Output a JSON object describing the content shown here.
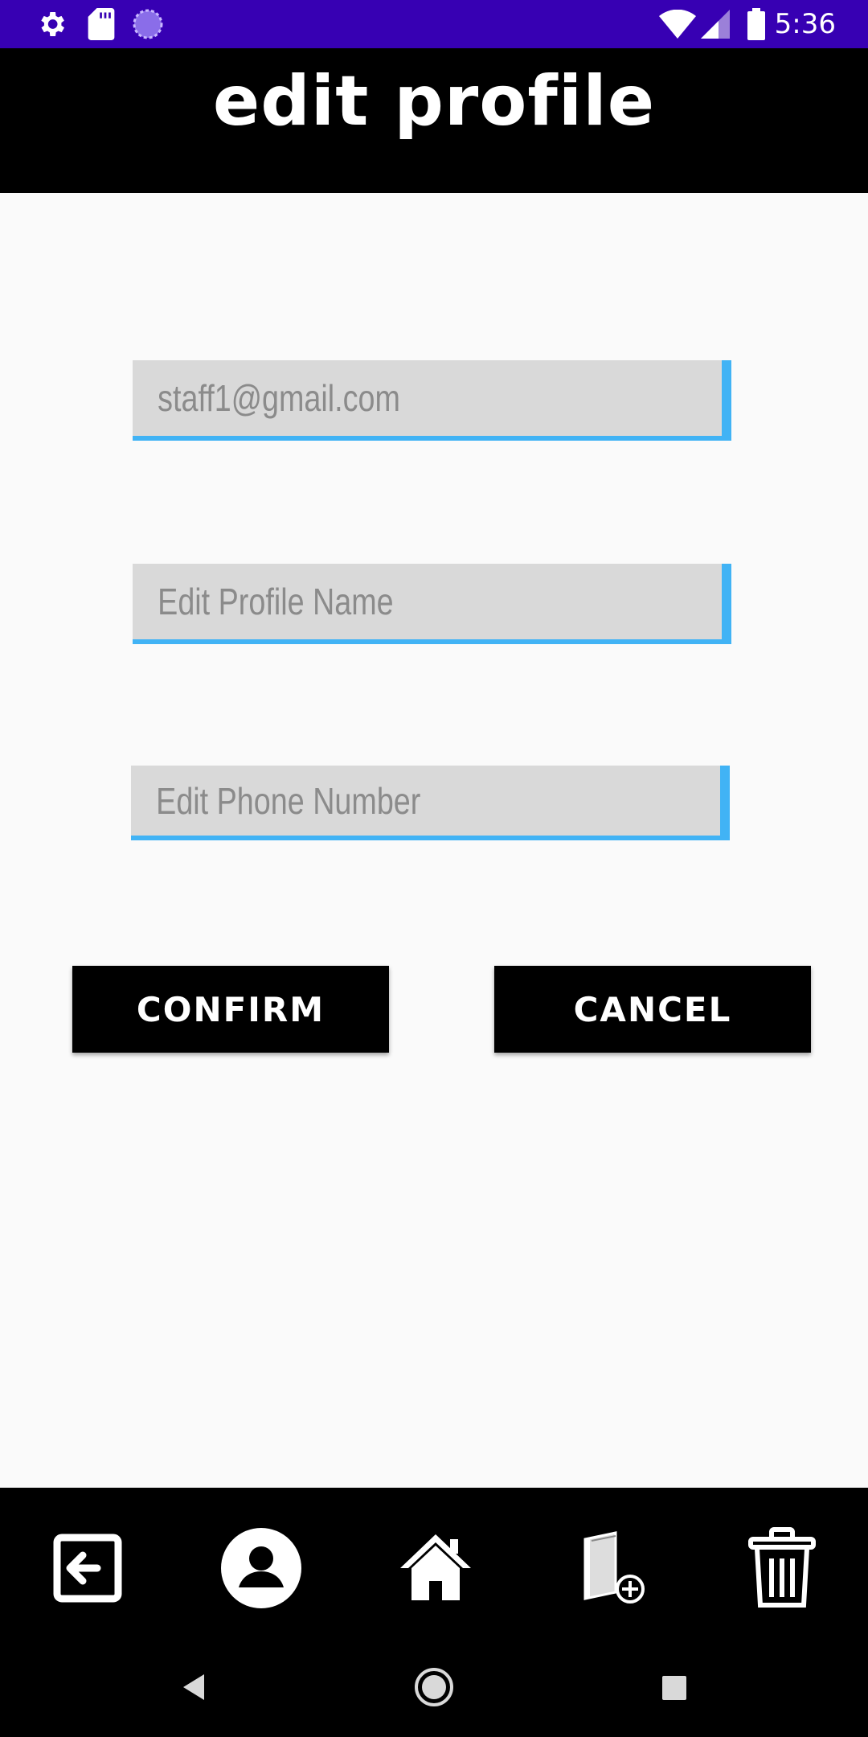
{
  "status_bar": {
    "time": "5:36",
    "icons": [
      "settings-icon",
      "sd-card-icon",
      "sync-icon",
      "wifi-icon",
      "signal-icon",
      "battery-icon"
    ]
  },
  "header": {
    "title": "edit profile"
  },
  "form": {
    "email": {
      "value": "",
      "placeholder": "staff1@gmail.com"
    },
    "profile_name": {
      "value": "",
      "placeholder": "Edit Profile Name"
    },
    "phone_number": {
      "value": "",
      "placeholder": "Edit Phone Number"
    }
  },
  "buttons": {
    "confirm_label": "CONFIRM",
    "cancel_label": "CANCEL"
  },
  "bottom_nav": {
    "items": [
      "logout-icon",
      "profile-icon",
      "home-icon",
      "add-book-icon",
      "trash-icon"
    ]
  },
  "system_nav": {
    "items": [
      "back-icon",
      "home-circle-icon",
      "recents-icon"
    ]
  },
  "colors": {
    "status_bar": "#3700b3",
    "header": "#000000",
    "field_bg": "#d9d9d9",
    "field_accent": "#41b3f5",
    "button_bg": "#000000",
    "button_text": "#ffffff",
    "placeholder": "#8b8b8b",
    "page_bg": "#fafafa"
  }
}
